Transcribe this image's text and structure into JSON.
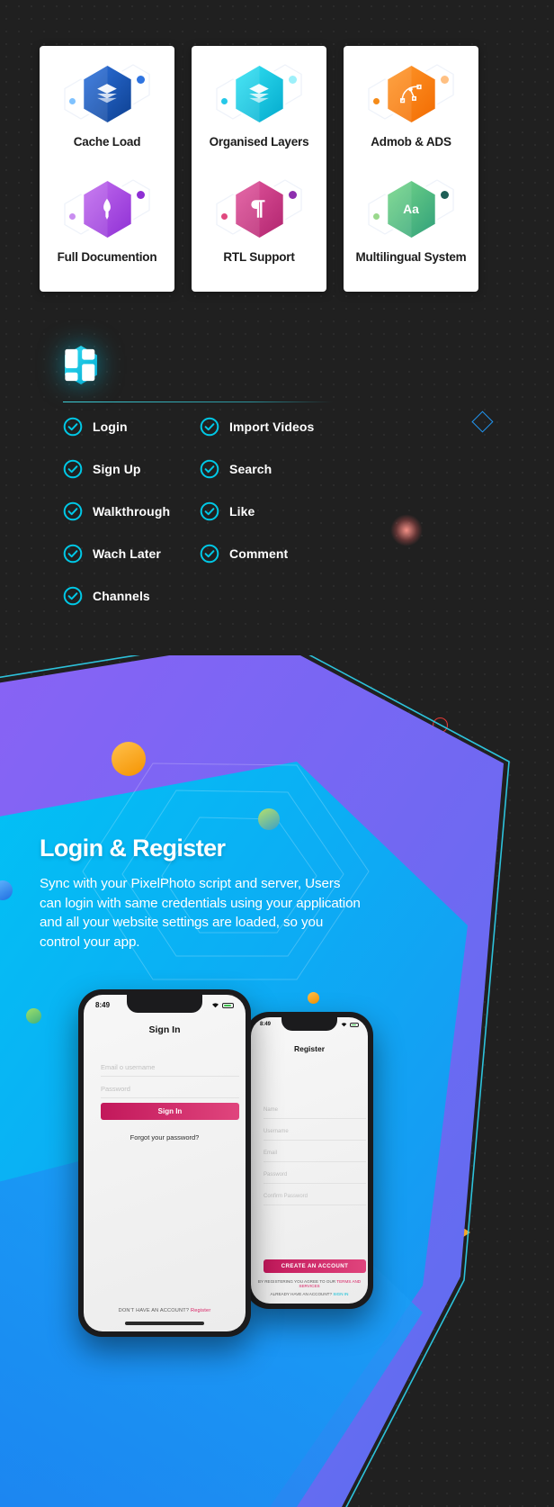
{
  "features_cards": [
    {
      "items": [
        {
          "title": "Cache Load",
          "icon": "layers-stack-icon",
          "c1": "#2f74e0",
          "c2": "#0d3f8f",
          "dotL": "#7fc2ff",
          "dotR": "#2f74e0"
        },
        {
          "title": "Full Documention",
          "icon": "pen-nib-icon",
          "c1": "#c46ff0",
          "c2": "#8e2fd4",
          "dotL": "#c98df0",
          "dotR": "#8e2fd4"
        }
      ]
    },
    {
      "items": [
        {
          "title": "Organised Layers",
          "icon": "layers-stack-icon",
          "c1": "#35e4f5",
          "c2": "#03a9cc",
          "dotL": "#25c8e8",
          "dotR": "#9df0fa"
        },
        {
          "title": "RTL Support",
          "icon": "paragraph-rtl-icon",
          "c1": "#e4589f",
          "c2": "#b0246e",
          "dotL": "#e0497f",
          "dotR": "#8e2fae"
        }
      ]
    },
    {
      "items": [
        {
          "title": "Admob & ADS",
          "icon": "vector-path-icon",
          "c1": "#ff9a2e",
          "c2": "#f26a00",
          "dotL": "#f58b18",
          "dotR": "#ffc082"
        },
        {
          "title": "Multilingual System",
          "icon": "aa-text-icon",
          "c1": "#79d98a",
          "c2": "#2f9f7a",
          "dotL": "#9ad88c",
          "dotR": "#1e5f56"
        }
      ]
    }
  ],
  "feature_list": {
    "logo_icon": "hex-dashboard-logo",
    "items": [
      {
        "label": "Login",
        "icon": "check-circle-icon"
      },
      {
        "label": "Import Videos",
        "icon": "check-circle-icon"
      },
      {
        "label": "Sign Up",
        "icon": "check-circle-icon"
      },
      {
        "label": "Search",
        "icon": "check-circle-icon"
      },
      {
        "label": "Walkthrough",
        "icon": "check-circle-icon"
      },
      {
        "label": "Like",
        "icon": "check-circle-icon"
      },
      {
        "label": "Wach Later",
        "icon": "check-circle-icon"
      },
      {
        "label": "Comment",
        "icon": "check-circle-icon"
      },
      {
        "label": "Channels",
        "icon": "check-circle-icon"
      }
    ]
  },
  "hero": {
    "title": "Login & Register",
    "body": "Sync with your PixelPhoto script and server, Users can login with same credentials using your application and all your website settings are loaded, so you control your app."
  },
  "phone_signin": {
    "status_time": "8:49",
    "title": "Sign In",
    "email_placeholder": "Email o username",
    "password_placeholder": "Password",
    "submit_label": "Sign In",
    "forgot_label": "Forgot your password?",
    "footer_prefix": "DON'T HAVE AN ACCOUNT?",
    "footer_link": "Register"
  },
  "phone_register": {
    "status_time": "8:49",
    "title": "Register",
    "submit_label": "CREATE AN ACCOUNT",
    "terms_prefix": "BY REGISTERING YOU AGREE TO OUR",
    "terms_link": "TERMS AND SERVICES",
    "footer_prefix": "ALREADY HAVE AN ACCOUNT?",
    "footer_link": "SIGN IN"
  },
  "decorations": [
    {
      "name": "diamond-outline",
      "color": "#2196f3"
    },
    {
      "name": "pink-glow-blob",
      "color": "#e98a80"
    },
    {
      "name": "red-ring",
      "color": "#e53935"
    },
    {
      "name": "orange-triangle",
      "color": "#f5a623"
    }
  ],
  "colors": {
    "background": "#202020",
    "accent_cyan": "#00c8e6",
    "hero_purple": "#7b5cf0",
    "hero_blue": "#18a9f7",
    "button_pink": "#c2185b"
  }
}
